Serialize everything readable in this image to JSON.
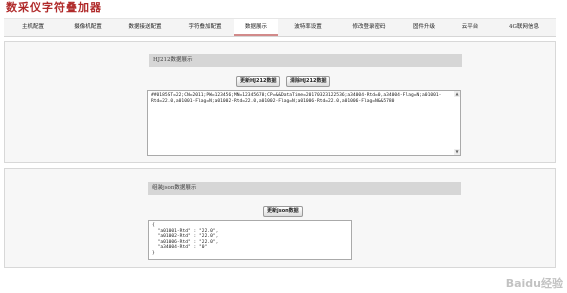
{
  "app": {
    "title": "数采仪字符叠加器"
  },
  "nav": {
    "items": [
      {
        "label": "主机配置"
      },
      {
        "label": "摄像机配置"
      },
      {
        "label": "数据接送配置"
      },
      {
        "label": "字符叠加配置"
      },
      {
        "label": "数据展示",
        "active": true
      },
      {
        "label": "波特率设置"
      },
      {
        "label": "修改登录密码"
      },
      {
        "label": "固件升级"
      },
      {
        "label": "云平台"
      },
      {
        "label": "4G联网信息"
      }
    ]
  },
  "hj212": {
    "section_title": "HJ212数据展示",
    "update_label": "更新HJ212数据",
    "clear_label": "清除HJ212数据",
    "content": "##0185ST=22;CN=2011;PW=123456;MN=12345678;CP=&&DataTime=20170323122536;a34004-Rtd=0,a34004-Flag=N;a01001-Rtd=22.0,a01001-Flag=N;a01002-Rtd=22.0,a01002-Flag=N;a01006-Rtd=22.0,a01006-Flag=N&&5780"
  },
  "json_panel": {
    "section_title": "组装json数据展示",
    "update_label": "更新json数据",
    "content": "{\n  \"a01001-Rtd\" : \"22.0\",\n  \"a01002-Rtd\" : \"22.0\",\n  \"a01006-Rtd\" : \"22.0\",\n  \"a34004-Rtd\" : \"0\"\n}"
  },
  "watermark": {
    "text": "Baidu经验"
  }
}
